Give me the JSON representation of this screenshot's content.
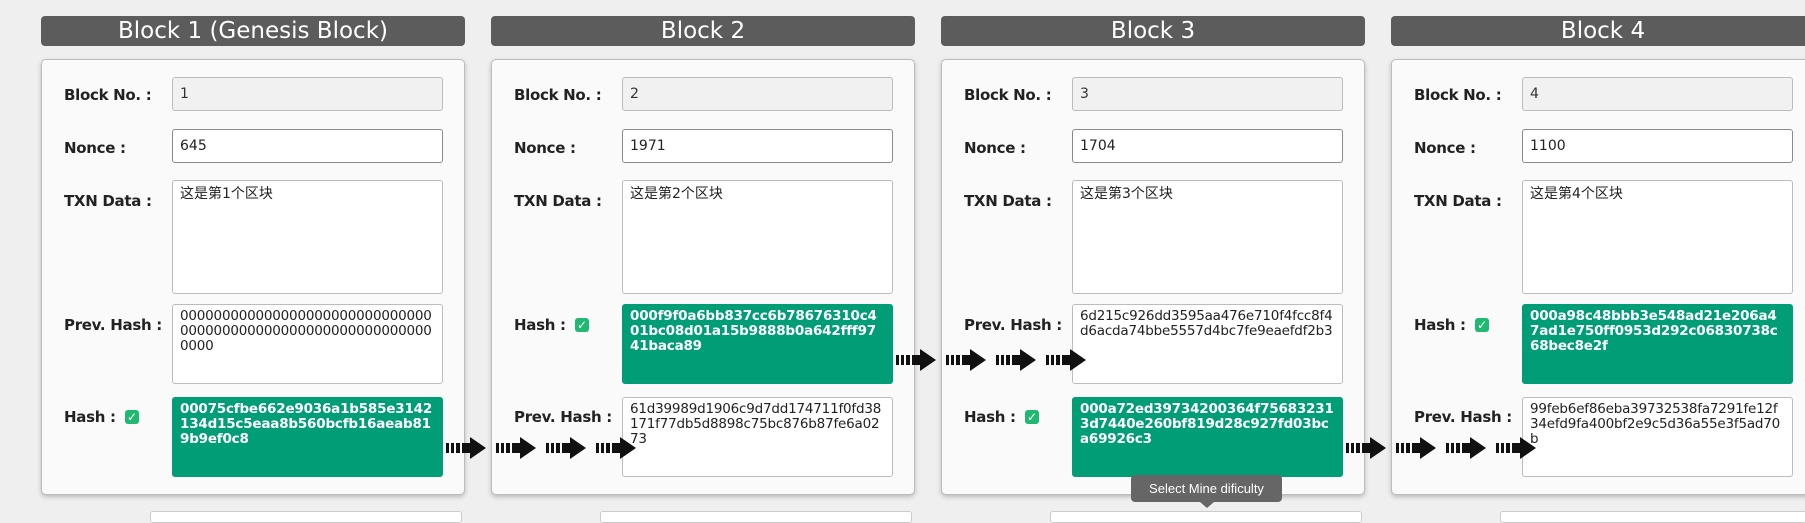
{
  "labels": {
    "block_no": "Block No. :",
    "nonce": "Nonce :",
    "txn_data": "TXN Data :",
    "prev_hash": "Prev. Hash :",
    "hash": "Hash :"
  },
  "blocks": [
    {
      "title": "Block 1 (Genesis Block)",
      "block_no": "1",
      "nonce": "645",
      "txn_data": "这是第1个区块",
      "prev_hash": "0000000000000000000000000000000000000000000000000000000000000000",
      "hash": "00075cfbe662e9036a1b585e3142134d15c5eaa8b560bcfb16aeab819b9ef0c8"
    },
    {
      "title": "Block 2",
      "block_no": "2",
      "nonce": "1971",
      "txn_data": "这是第2个区块",
      "hash": "000f9f0a6bb837cc6b78676310c401bc08d01a15b9888b0a642fff9741baca89",
      "prev_hash": "61d39989d1906c9d7dd174711f0fd38171f77db5d8898c75bc876b87⁠fe6a0273"
    },
    {
      "title": "Block 3",
      "block_no": "3",
      "nonce": "1704",
      "txn_data": "这是第3个区块",
      "prev_hash": "6d215c926dd3595aa476e710f4fcc8f4d6acda74bbe5557d4bc7fe9eaefdf2b3",
      "hash": "000a72ed39734200364f756832313d7440e260bf819d28c927fd03bca69926c3"
    },
    {
      "title": "Block 4",
      "block_no": "4",
      "nonce": "1100",
      "txn_data": "这是第4个区块",
      "hash": "000a98c48bbb3e548ad21e206a47ad1e750ff0953d292c06830738c68bec8e2f",
      "prev_hash": "99feb6ef86eba39732538fa7291fe12f34efd9fa400bf2e9c5d36a55e3f5ad70b"
    }
  ],
  "tooltip": "Select Mine dificulty",
  "colors": {
    "hash_bg": "#009d77",
    "check": "#21b873",
    "header": "#5c5c5c"
  }
}
